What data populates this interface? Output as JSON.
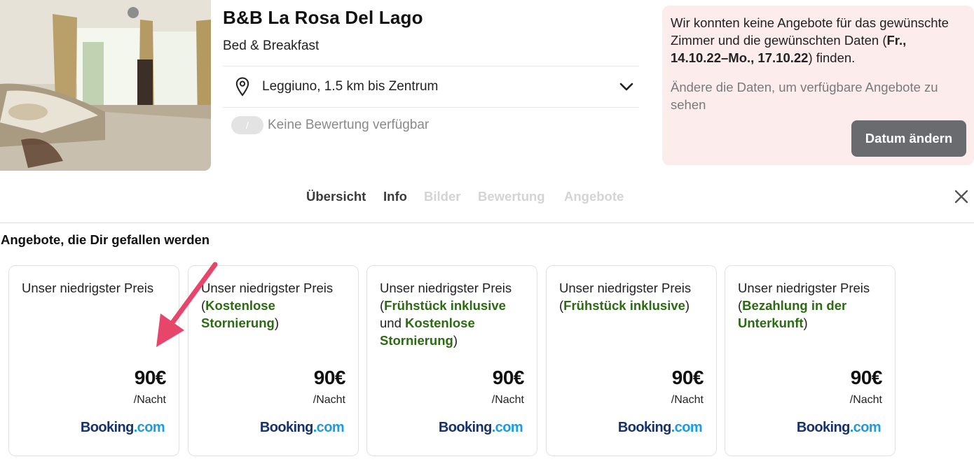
{
  "hotel": {
    "name": "B&B La Rosa Del Lago",
    "type": "Bed & Breakfast",
    "location": "Leggiuno, 1.5 km bis Zentrum",
    "rating_badge": "/",
    "rating_text": "Keine Bewertung verfügbar"
  },
  "notice": {
    "msg_prefix": "Wir konnten keine Angebote für das gewünschte Zimmer und die gewünschten Daten (",
    "dates": "Fr., 14.10.22–Mo., 17.10.22",
    "msg_suffix": ") finden.",
    "hint": "Ändere die Daten, um verfügbare Angebote zu sehen",
    "button_label": "Datum ändern"
  },
  "tabs": [
    {
      "label": "Übersicht",
      "state": "active"
    },
    {
      "label": "Info",
      "state": "active"
    },
    {
      "label": "Bilder",
      "state": "disabled"
    },
    {
      "label": "Bewertung",
      "state": "disabled"
    },
    {
      "label": "Angebote",
      "state": "disabled"
    }
  ],
  "section_title": "Angebote, die Dir gefallen werden",
  "offers": [
    {
      "title": "Unser niedrigster Preis",
      "open": "",
      "feat1": "",
      "conj": "",
      "feat2": "",
      "close": "",
      "price": "90€",
      "per": "/Nacht",
      "provider_a": "Booking",
      "provider_b": ".com"
    },
    {
      "title": "Unser niedrigster Preis",
      "open": "(",
      "feat1": "Kostenlose Stornierung",
      "conj": "",
      "feat2": "",
      "close": ")",
      "price": "90€",
      "per": "/Nacht",
      "provider_a": "Booking",
      "provider_b": ".com"
    },
    {
      "title": "Unser niedrigster Preis",
      "open": "(",
      "feat1": "Frühstück inklusive",
      "conj": " und ",
      "feat2": "Kostenlose Stornierung",
      "close": ")",
      "price": "90€",
      "per": "/Nacht",
      "provider_a": "Booking",
      "provider_b": ".com"
    },
    {
      "title": "Unser niedrigster Preis",
      "open": "(",
      "feat1": "Frühstück inklusive",
      "conj": "",
      "feat2": "",
      "close": ")",
      "price": "90€",
      "per": "/Nacht",
      "provider_a": "Booking",
      "provider_b": ".com"
    },
    {
      "title": "Unser niedrigster Preis",
      "open": "(",
      "feat1": "Bezahlung in der Unterkunft",
      "conj": "",
      "feat2": "",
      "close": ")",
      "price": "90€",
      "per": "/Nacht",
      "provider_a": "Booking",
      "provider_b": ".com"
    }
  ],
  "colors": {
    "feature_green": "#2b6b12",
    "notice_bg": "#fcecec",
    "arrow": "#e8456b",
    "booking_dark": "#16326b",
    "booking_light": "#1c9ae3"
  },
  "icons": [
    "location-pin-icon",
    "chevron-down-icon",
    "close-icon",
    "annotation-arrow-icon"
  ]
}
